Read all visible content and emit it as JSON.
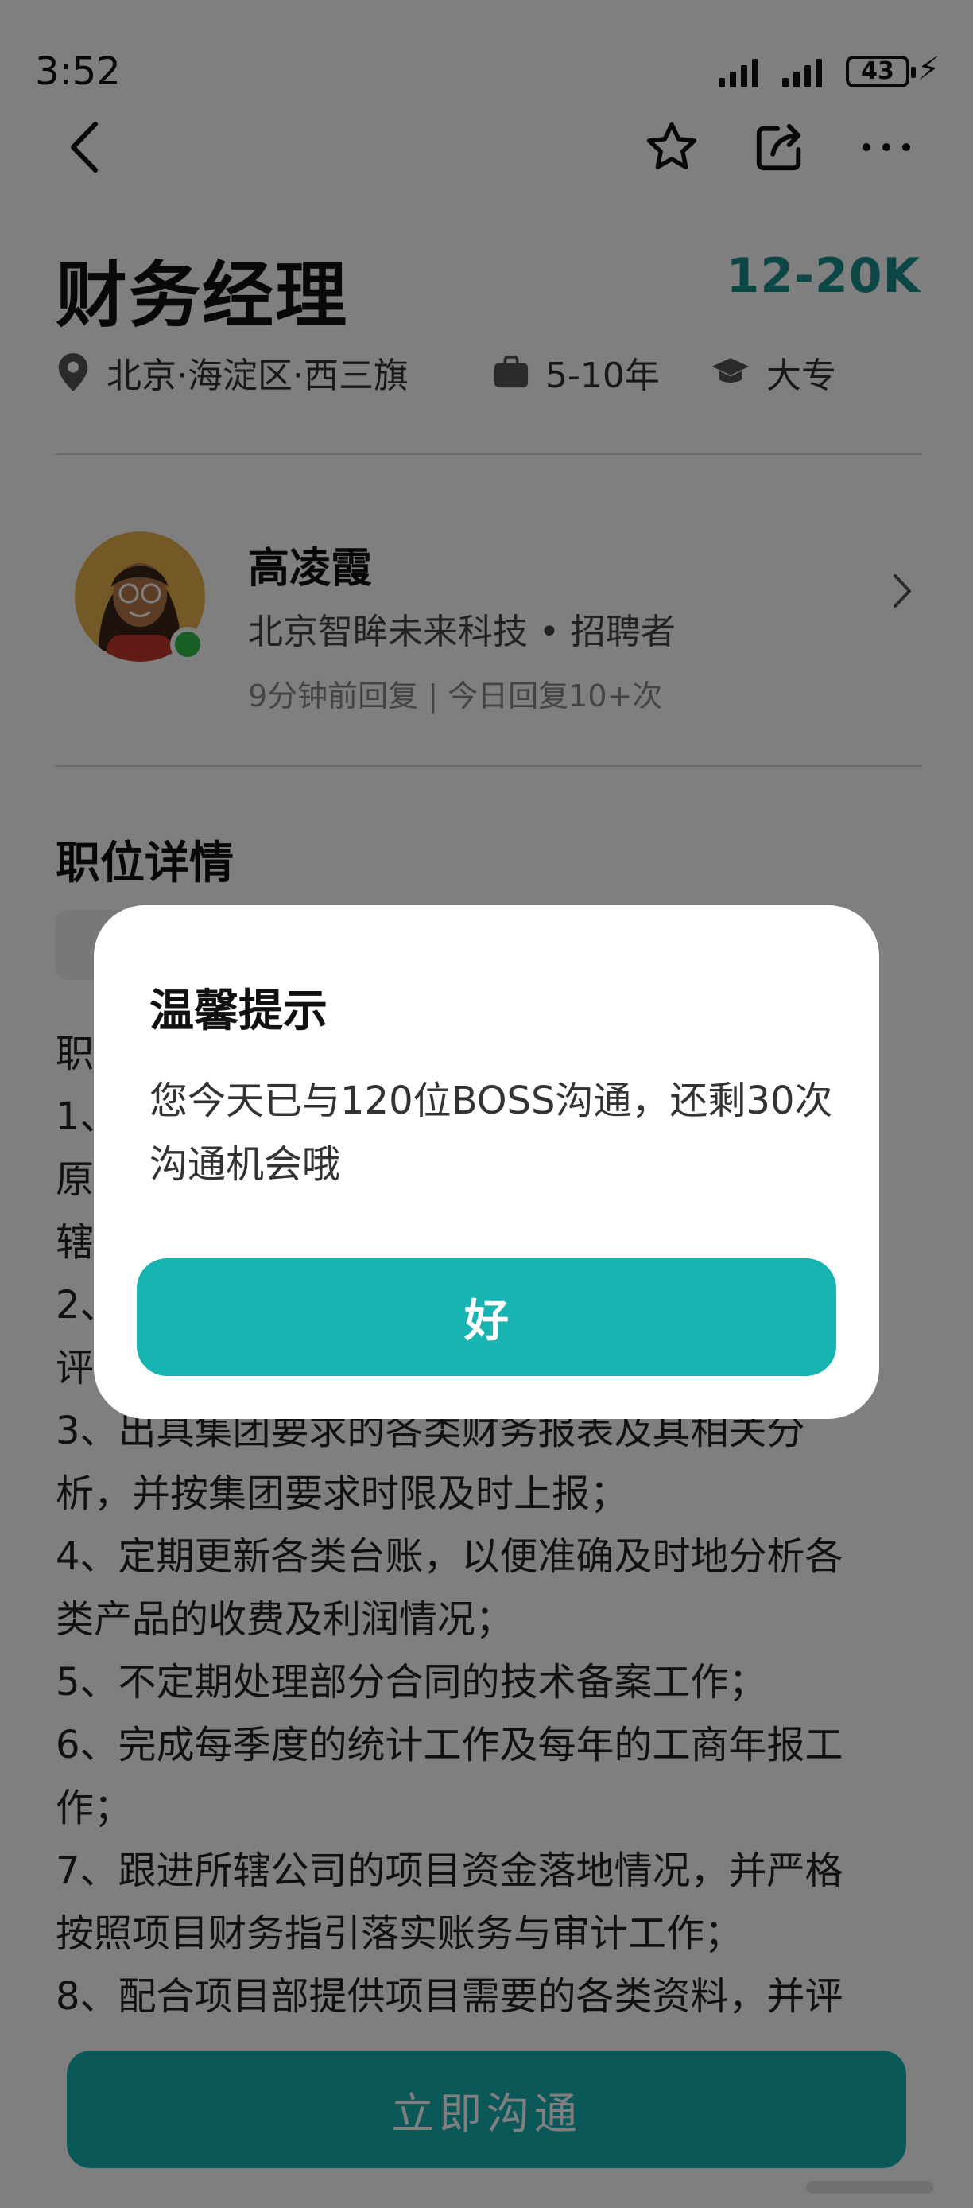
{
  "status_bar": {
    "time": "3:52",
    "battery": "43"
  },
  "job": {
    "title": "财务经理",
    "salary": "12-20K",
    "location": "北京·海淀区·西三旗",
    "experience": "5-10年",
    "education": "大专"
  },
  "recruiter": {
    "name": "高凌霞",
    "company_role": "北京智眸未来科技 • 招聘者",
    "activity": "9分钟前回复 | 今日回复10+次"
  },
  "details": {
    "section_title": "职位详情",
    "lines": [
      "职",
      "1、",
      "原",
      "辖",
      "2、",
      "评",
      "3、出具集团要求的各类财务报表及其相关分",
      "析，并按集团要求时限及时上报；",
      "4、定期更新各类台账，以便准确及时地分析各",
      "类产品的收费及利润情况；",
      "5、不定期处理部分合同的技术备案工作；",
      "6、完成每季度的统计工作及每年的工商年报工",
      "作；",
      "7、跟进所辖公司的项目资金落地情况，并严格",
      "按照项目财务指引落实账务与审计工作；",
      "8、配合项目部提供项目需要的各类资料，并评"
    ]
  },
  "cta": {
    "label": "立即沟通"
  },
  "dialog": {
    "title": "温馨提示",
    "message": "您今天已与120位BOSS沟通，还剩30次沟通机会哦",
    "ok_label": "好"
  }
}
